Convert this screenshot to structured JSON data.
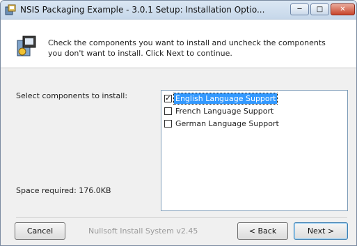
{
  "window": {
    "title": "NSIS Packaging Example - 3.0.1 Setup: Installation Optio..."
  },
  "header": {
    "text": "Check the components you want to install and uncheck the components you don't want to install. Click Next to continue."
  },
  "labels": {
    "select_components": "Select components to install:",
    "space_required": "Space required: 176.0KB"
  },
  "components": [
    {
      "label": "English Language Support",
      "checked": true,
      "selected": true
    },
    {
      "label": "French Language Support",
      "checked": false,
      "selected": false
    },
    {
      "label": "German Language Support",
      "checked": false,
      "selected": false
    }
  ],
  "footer": {
    "branding": "Nullsoft Install System v2.45",
    "cancel_label": "Cancel",
    "back_label": "< Back",
    "next_label": "Next >"
  },
  "icons": {
    "app": "installer-icon",
    "header": "installer-components-icon",
    "minimize": "minimize-icon",
    "maximize": "maximize-icon",
    "close": "close-icon"
  },
  "colors": {
    "selection": "#3399ff",
    "close_button": "#c8452b"
  }
}
